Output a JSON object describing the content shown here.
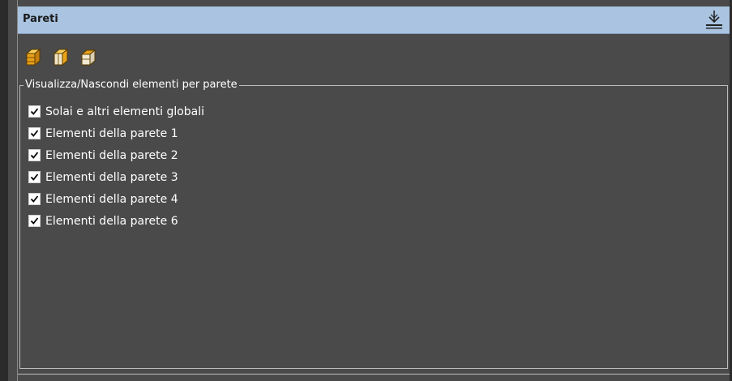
{
  "panel": {
    "title": "Pareti",
    "pin_icon": "download-pin-icon",
    "title_bg": "#a9c3e0"
  },
  "toolbar": {
    "buttons": [
      {
        "icon": "solid-box-icon"
      },
      {
        "icon": "half-box-icon"
      },
      {
        "icon": "wire-box-icon"
      }
    ]
  },
  "group": {
    "legend": "Visualizza/Nascondi elementi per parete",
    "items": [
      {
        "label": "Solai e altri elementi globali",
        "checked": true
      },
      {
        "label": "Elementi della parete 1",
        "checked": true
      },
      {
        "label": "Elementi della parete 2",
        "checked": true
      },
      {
        "label": "Elementi della parete 3",
        "checked": true
      },
      {
        "label": "Elementi della parete 4",
        "checked": true
      },
      {
        "label": "Elementi della parete 6",
        "checked": true
      }
    ]
  }
}
